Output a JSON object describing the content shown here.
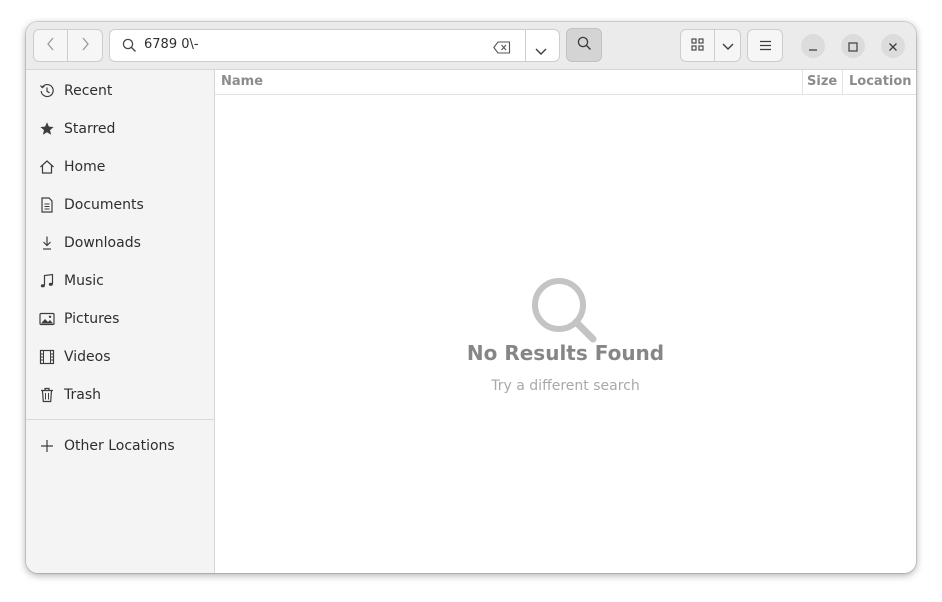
{
  "search": {
    "query": "6789 0\\-"
  },
  "sidebar": {
    "items": [
      {
        "label": "Recent",
        "icon": "clock-icon"
      },
      {
        "label": "Starred",
        "icon": "star-icon"
      },
      {
        "label": "Home",
        "icon": "home-icon"
      },
      {
        "label": "Documents",
        "icon": "document-icon"
      },
      {
        "label": "Downloads",
        "icon": "download-icon"
      },
      {
        "label": "Music",
        "icon": "music-note-icon"
      },
      {
        "label": "Pictures",
        "icon": "picture-icon"
      },
      {
        "label": "Videos",
        "icon": "film-icon"
      },
      {
        "label": "Trash",
        "icon": "trash-icon"
      }
    ],
    "other_locations": {
      "label": "Other Locations",
      "icon": "plus-icon"
    }
  },
  "columns": {
    "name": "Name",
    "size": "Size",
    "location": "Location"
  },
  "empty_state": {
    "title": "No Results Found",
    "subtitle": "Try a different search",
    "icon": "magnifier-icon"
  },
  "colors": {
    "search_button_active": "#d4d4d4",
    "headerbar": "#ebebeb",
    "sidebar": "#f4f4f4"
  }
}
